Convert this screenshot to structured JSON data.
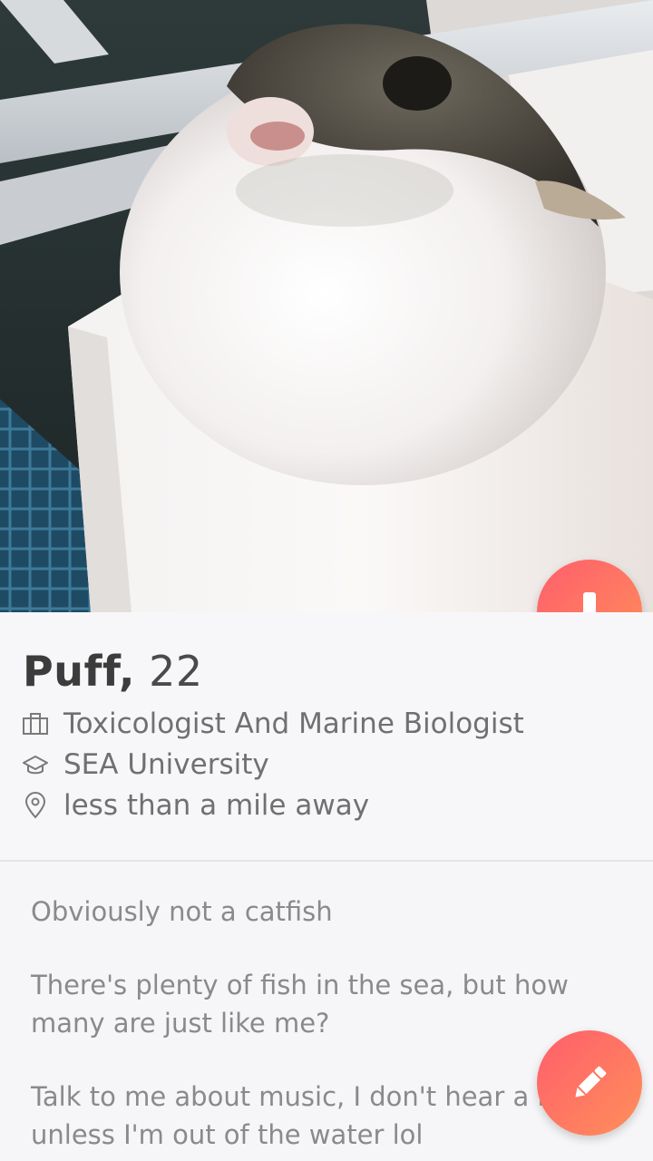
{
  "profile": {
    "name": "Puff,",
    "age": "22",
    "job": "Toxicologist And Marine Biologist",
    "school": "SEA University",
    "distance": "less than a mile away"
  },
  "bio": {
    "line1": "Obviously not a catfish",
    "line2a": "There's plenty of fish in the sea, but how",
    "line2b": "many are just like me?",
    "line3a": "Talk to me about music, I don't hear a lot",
    "line3b": "unless I'm out of the water lol"
  },
  "icons": {
    "job": "briefcase-icon",
    "school": "graduation-cap-icon",
    "distance": "location-pin-icon",
    "collapse": "arrow-down-icon",
    "edit": "pencil-icon"
  },
  "colors": {
    "accent_start": "#ff5e6c",
    "accent_end": "#ff8f5a",
    "name_text": "#3c3c3c",
    "detail_text": "#707070",
    "bio_text": "#8a8a8a"
  }
}
